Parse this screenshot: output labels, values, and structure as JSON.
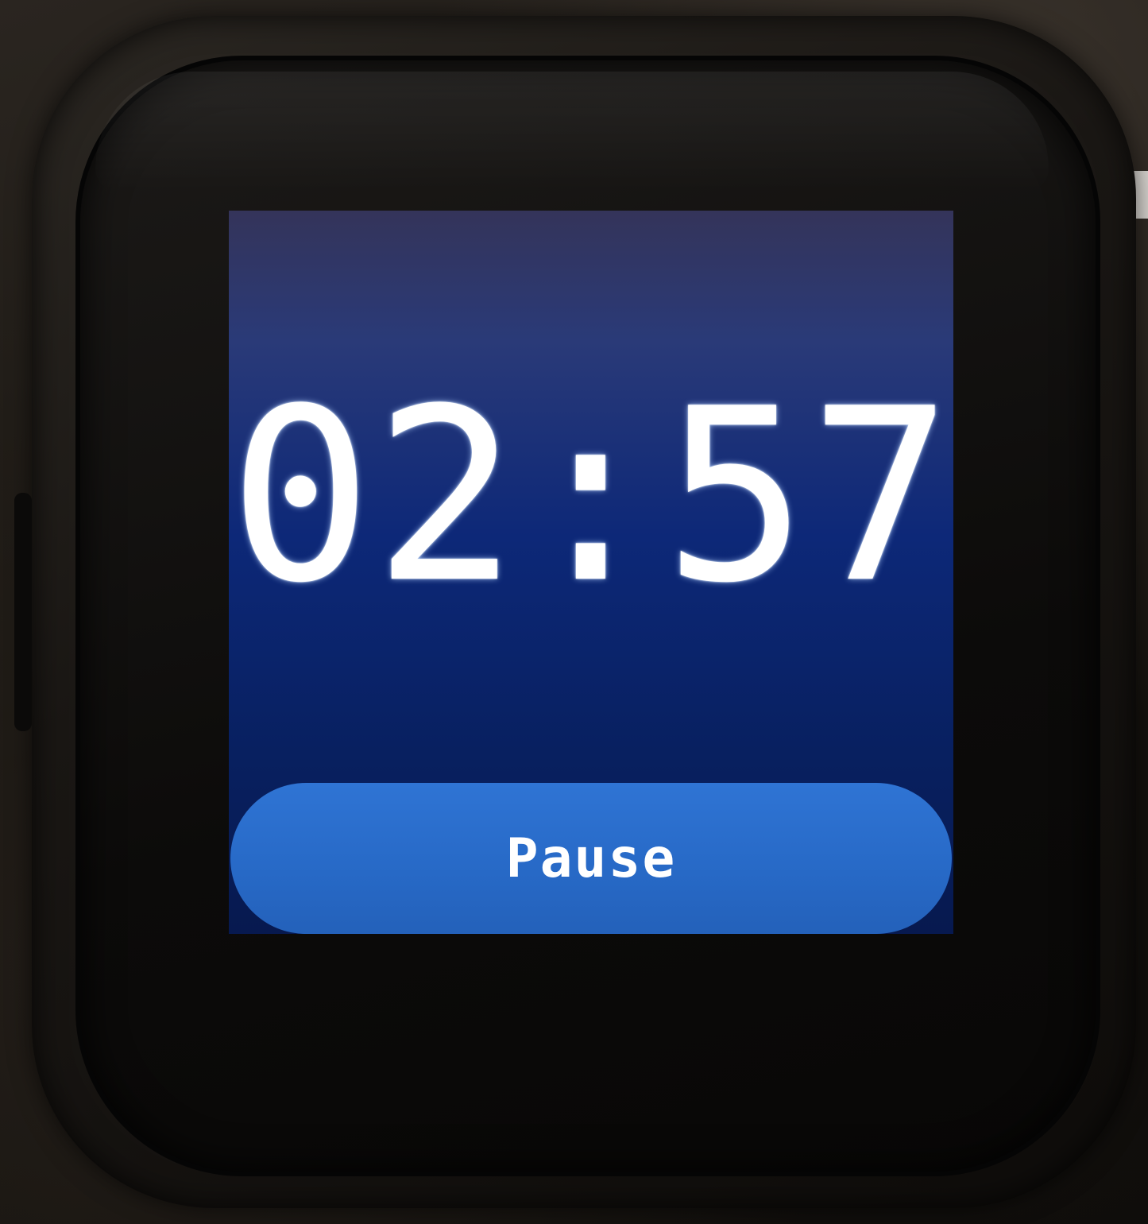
{
  "timer": {
    "display": "02:57"
  },
  "controls": {
    "pause_label": "Pause"
  },
  "colors": {
    "screen_top": "#34345a",
    "screen_bottom": "#07194f",
    "button_accent": "#2f74d4",
    "text": "#ffffff"
  }
}
